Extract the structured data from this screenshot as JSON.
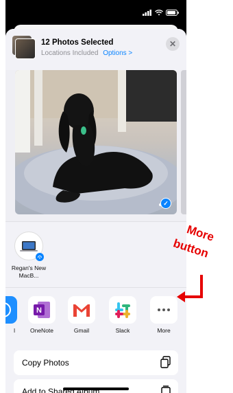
{
  "share_sheet": {
    "title": "12 Photos Selected",
    "subtitle": "Locations Included",
    "options_link": "Options >",
    "close_glyph": "✕"
  },
  "preview": {
    "selected_glyph": "✓"
  },
  "airdrop": {
    "device_label": "Regan's New MacB..."
  },
  "apps": [
    {
      "label": "l"
    },
    {
      "label": "OneNote"
    },
    {
      "label": "Gmail"
    },
    {
      "label": "Slack"
    },
    {
      "label": "More"
    }
  ],
  "actions": [
    {
      "label": "Copy Photos",
      "icon": "copy-icon"
    },
    {
      "label": "Add to Shared Album",
      "icon": "shared-album-icon"
    }
  ],
  "annotation": {
    "line1": "More",
    "line2": "button",
    "color": "#e60000"
  },
  "colors": {
    "accent": "#0a84ff",
    "onenote": "#7719aa",
    "gmail": "#ea4335"
  }
}
